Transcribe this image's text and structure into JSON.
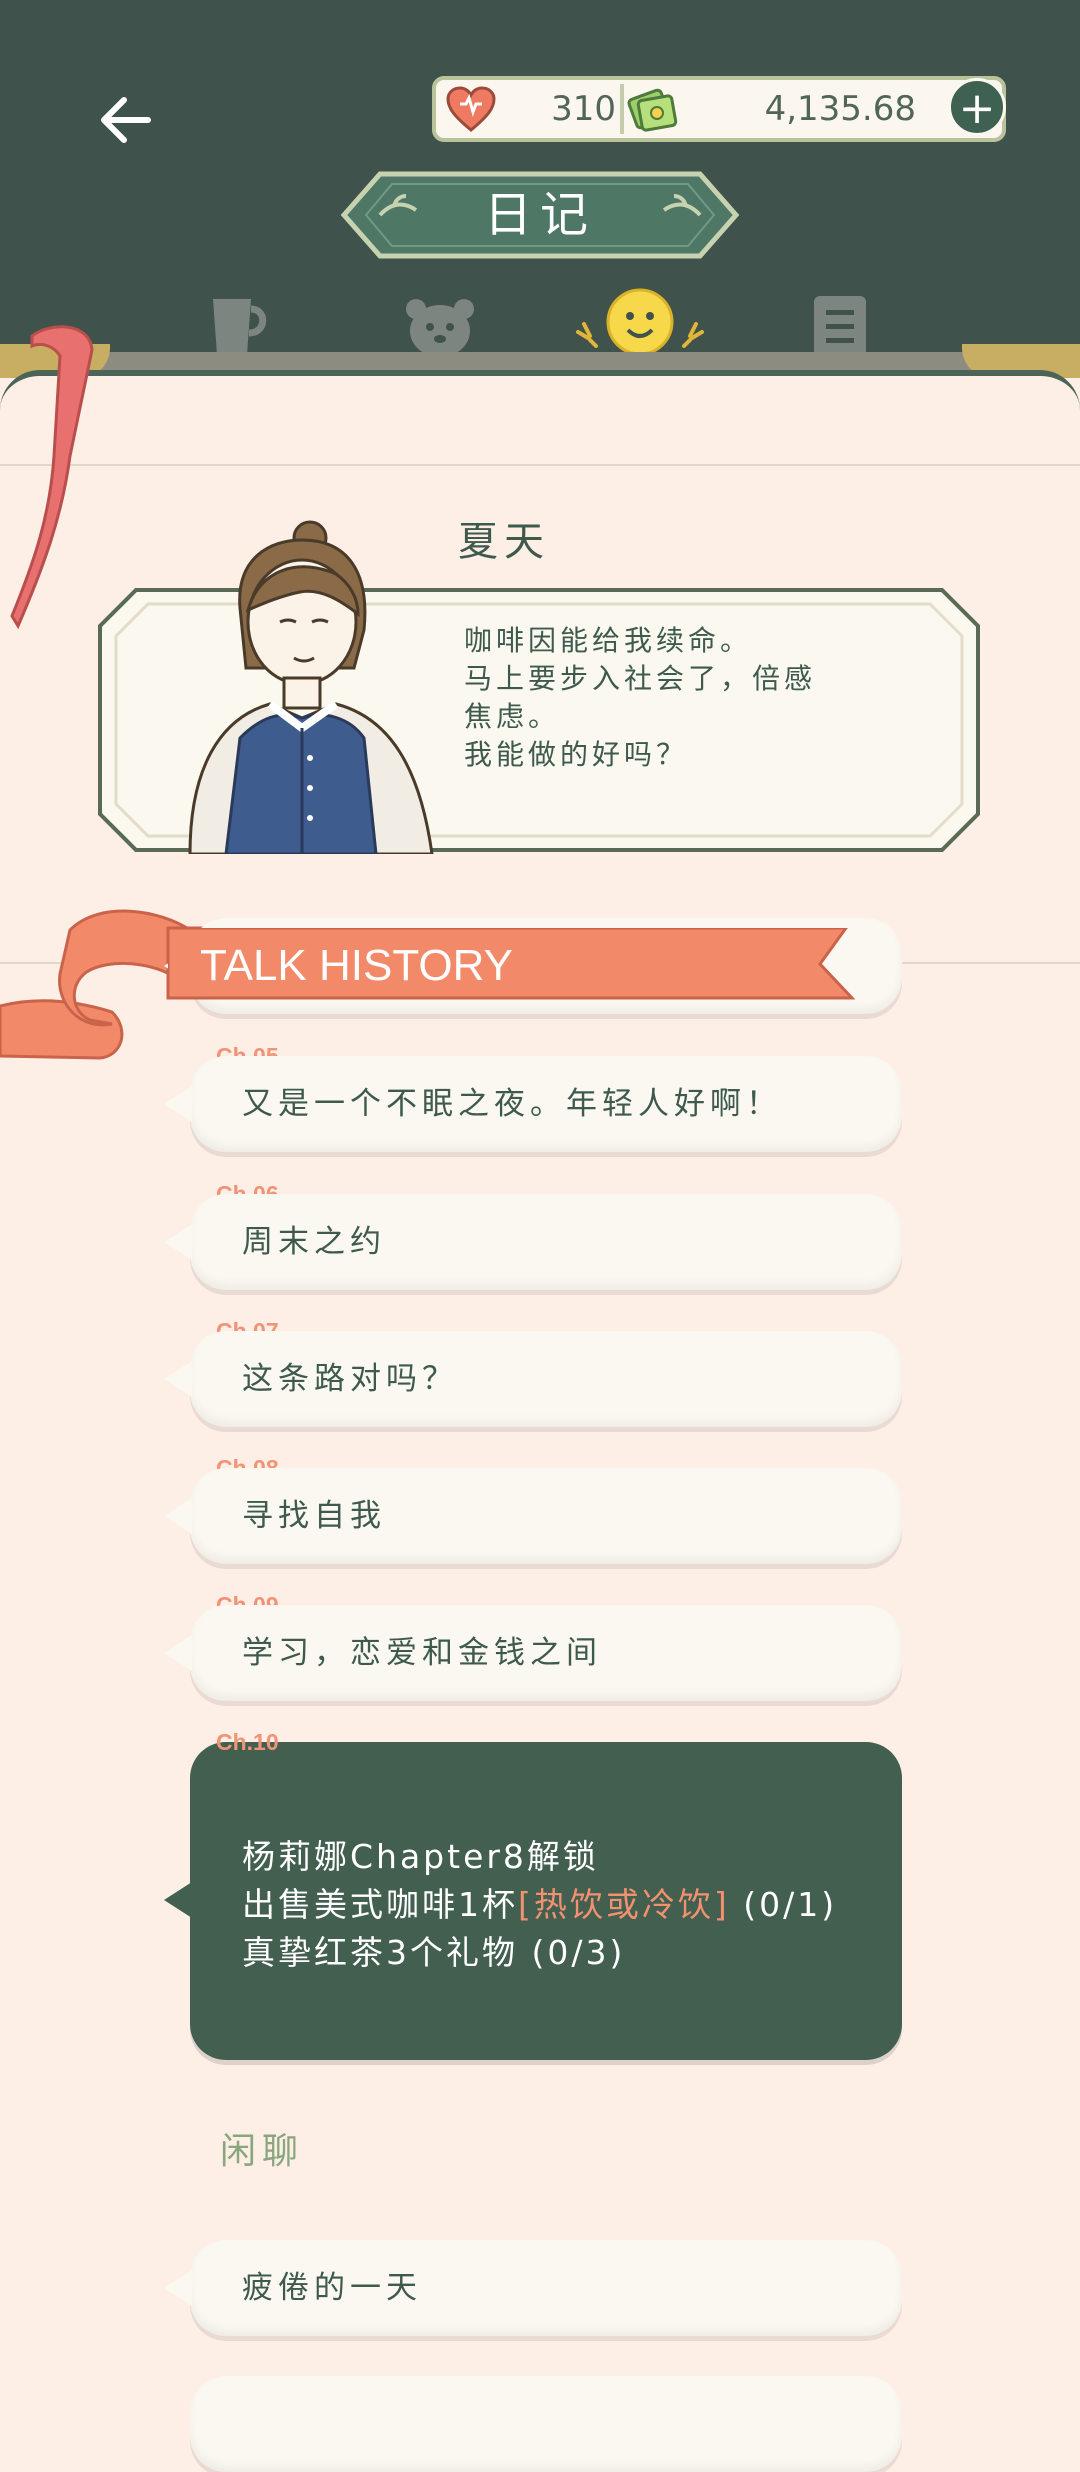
{
  "app": {
    "screen_title": "日记"
  },
  "currency": {
    "hearts": "310",
    "money": "4,135.68",
    "add_label": "+"
  },
  "tabs": [
    {
      "icon": "cup-icon",
      "active": false
    },
    {
      "icon": "bear-icon",
      "active": false
    },
    {
      "icon": "smiley-icon",
      "active": true
    },
    {
      "icon": "notes-icon",
      "active": false
    }
  ],
  "character": {
    "name": "夏天",
    "quote_lines": [
      "咖啡因能给我续命。",
      "马上要步入社会了，倍感",
      "焦虑。",
      "我能做的好吗？"
    ]
  },
  "talk_history": {
    "title": "TALK HISTORY",
    "chapters": [
      {
        "label": "Ch.05",
        "text": "又是一个不眠之夜。年轻人好啊！"
      },
      {
        "label": "Ch.06",
        "text": "周末之约"
      },
      {
        "label": "Ch.07",
        "text": "这条路对吗？"
      },
      {
        "label": "Ch.08",
        "text": "寻找自我"
      },
      {
        "label": "Ch.09",
        "text": "学习，恋爱和金钱之间"
      }
    ],
    "locked": {
      "label": "Ch.10",
      "line1": "杨莉娜Chapter8解锁",
      "line2_prefix": "出售美式咖啡1杯",
      "line2_highlight": "[热饮或冷饮]",
      "line2_suffix": " (0/1)",
      "line3": "真挚红茶3个礼物 (0/3)"
    }
  },
  "chat": {
    "title": "闲聊",
    "items": [
      "疲倦的一天"
    ]
  },
  "colors": {
    "header": "#3f524b",
    "accent": "#f09376",
    "locked_bubble": "#425f50",
    "page": "#fdeee6"
  }
}
